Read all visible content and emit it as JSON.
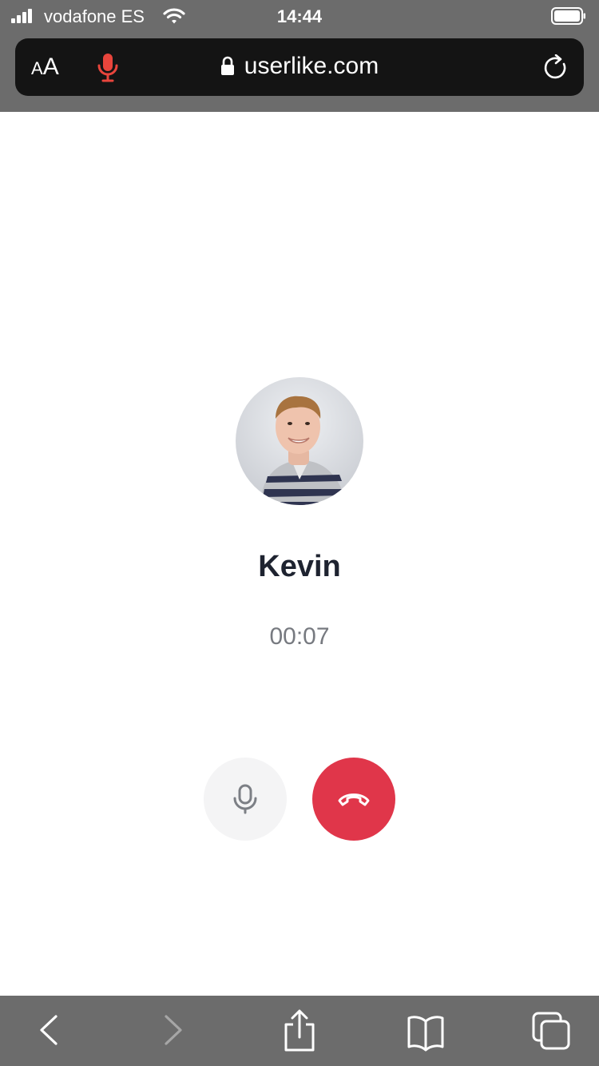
{
  "status_bar": {
    "carrier": "vodafone ES",
    "time": "14:44"
  },
  "browser": {
    "text_size_small": "A",
    "text_size_big": "A",
    "url": "userlike.com"
  },
  "call": {
    "name": "Kevin",
    "duration": "00:07"
  },
  "colors": {
    "hangup": "#e0364a",
    "mic_active": "#e8453c",
    "chrome": "#6c6c6c"
  },
  "icons": {
    "status": [
      "signal-icon",
      "wifi-icon",
      "battery-icon"
    ],
    "browser": [
      "text-size-icon",
      "microphone-icon",
      "lock-icon",
      "reload-icon"
    ],
    "call": [
      "mute-icon",
      "hang-up-icon"
    ],
    "toolbar": [
      "back-icon",
      "forward-icon",
      "share-icon",
      "bookmarks-icon",
      "tabs-icon"
    ]
  }
}
